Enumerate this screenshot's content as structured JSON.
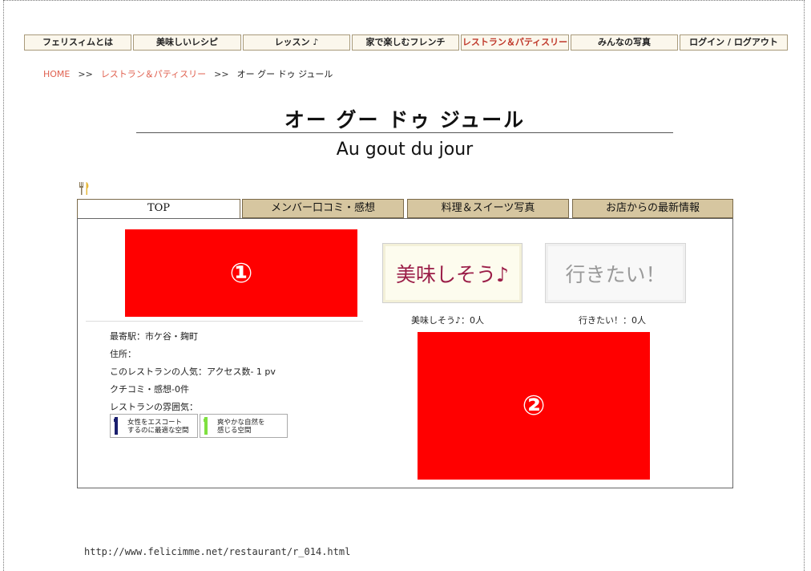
{
  "nav": {
    "items": [
      {
        "label": "フェリスィムとは",
        "w": 132
      },
      {
        "label": "美味しいレシピ",
        "w": 133
      },
      {
        "label": "レッスン ♪",
        "w": 132
      },
      {
        "label": "家で楽しむフレンチ",
        "w": 132
      },
      {
        "label": "レストラン＆パティスリー",
        "w": 133
      },
      {
        "label": "みんなの写真",
        "w": 132
      },
      {
        "label": "ログイン / ログアウト",
        "w": 133
      }
    ]
  },
  "breadcrumb": {
    "home": "HOME",
    "sep": ">>",
    "category": "レストラン＆パティスリー",
    "current": "オー グー ドゥ ジュール"
  },
  "header": {
    "title_jp": "オー グー ドゥ ジュール",
    "title_en": "Au gout du jour"
  },
  "tabs": [
    {
      "label": "TOP"
    },
    {
      "label": "メンバー口コミ・感想"
    },
    {
      "label": "料理＆スイーツ写真"
    },
    {
      "label": "お店からの最新情報"
    }
  ],
  "placeholders": {
    "one": "①",
    "two": "②"
  },
  "actions": {
    "tasty_label": "美味しそう♪",
    "want_label": "行きたい！",
    "tasty_count": "美味しそう♪：0人",
    "want_count": "行きたい！：0人"
  },
  "info": {
    "station": "最寄駅：市ケ谷・麹町",
    "address": "住所：",
    "popularity": "このレストランの人気：アクセス数- 1 pv",
    "reviews": "クチコミ・感想-0件",
    "atmosphere": "レストランの雰囲気："
  },
  "badges": [
    {
      "line1": "女性をエスコート",
      "line2": "するのに最適な空間",
      "color": "#1a1f6e"
    },
    {
      "line1": "爽やかな自然を",
      "line2": "感じる空間",
      "color": "#7fe040"
    }
  ],
  "footer": {
    "url": "http://www.felicimme.net/restaurant/r_014.html"
  },
  "colors": {
    "accent": "#e0604f",
    "tab_bg": "#d6c6a0",
    "placeholder_red": "#ff0000",
    "tasty_text": "#9b1e48"
  }
}
